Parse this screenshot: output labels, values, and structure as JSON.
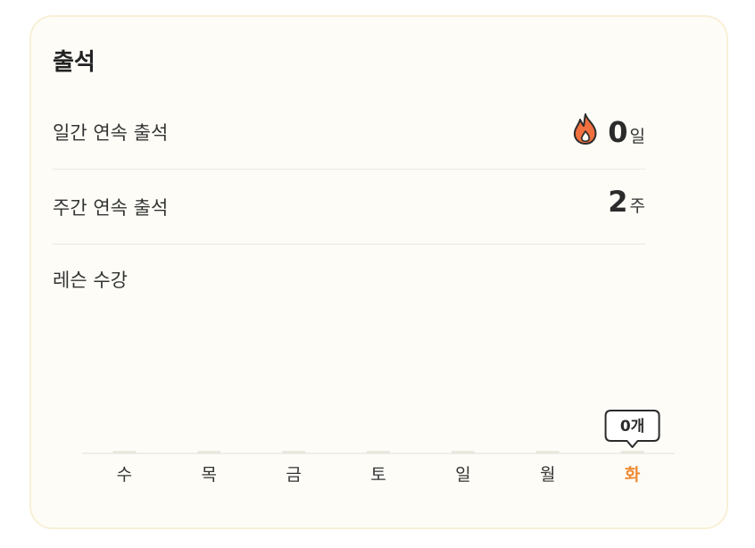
{
  "card": {
    "title": "출석",
    "daily_streak": {
      "label": "일간 연속 출석",
      "value": "0",
      "unit": "일",
      "icon": "flame-icon"
    },
    "weekly_streak": {
      "label": "주간 연속 출석",
      "value": "2",
      "unit": "주"
    },
    "lesson": {
      "label": "레슨 수강"
    }
  },
  "colors": {
    "accent": "#ef8a33",
    "flame": "#f0703f",
    "card_bg": "#fdfcf7",
    "card_border": "#f8f0d6",
    "bar": "#ece9e2"
  },
  "chart_data": {
    "type": "bar",
    "categories": [
      "수",
      "목",
      "금",
      "토",
      "일",
      "월",
      "화"
    ],
    "values": [
      0,
      0,
      0,
      0,
      0,
      0,
      0
    ],
    "highlight_index": 6,
    "tooltip": "0개",
    "title": "",
    "xlabel": "",
    "ylabel": ""
  }
}
